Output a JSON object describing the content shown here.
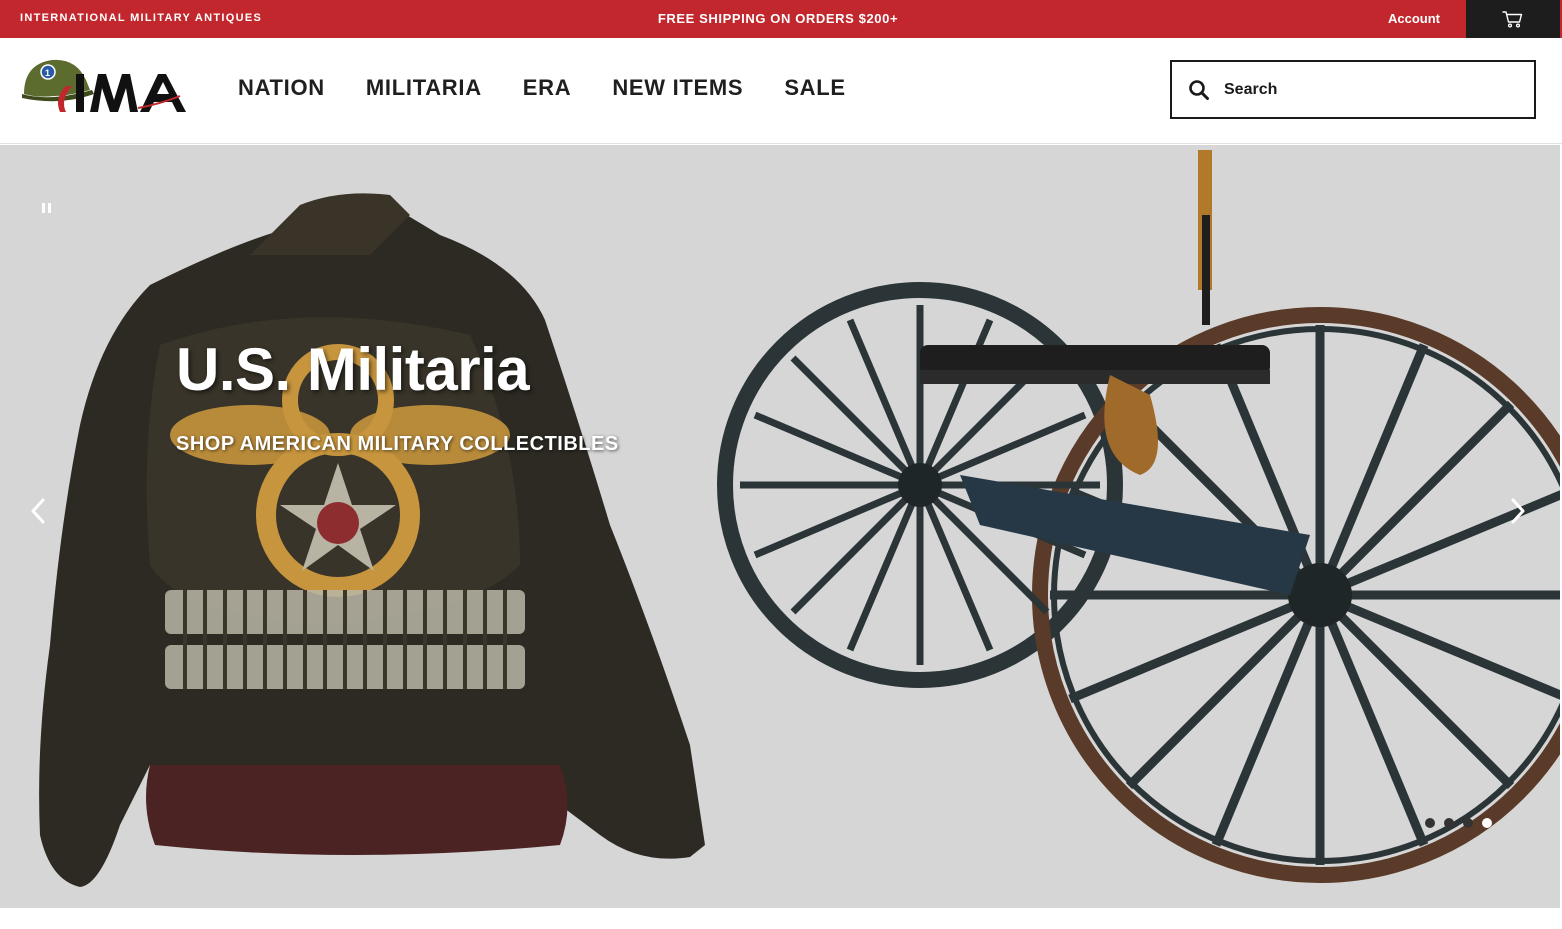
{
  "topbar": {
    "brand_text": "INTERNATIONAL MILITARY ANTIQUES",
    "promo_text": "FREE SHIPPING ON ORDERS $200+",
    "account_label": "Account",
    "cart_icon": "cart-icon",
    "background_color": "#c1272d"
  },
  "header": {
    "logo_text": "IMA",
    "nav": [
      "NATION",
      "MILITARIA",
      "ERA",
      "NEW ITEMS",
      "SALE"
    ],
    "search_placeholder": "Search",
    "search_icon": "search-icon"
  },
  "hero": {
    "title": "U.S. Militaria",
    "subtitle": "SHOP AMERICAN MILITARY COLLECTIBLES",
    "slide_count": 4,
    "active_slide": 4,
    "pause_icon": "pause-icon",
    "prev_icon": "chevron-left-icon",
    "next_icon": "chevron-right-icon"
  }
}
